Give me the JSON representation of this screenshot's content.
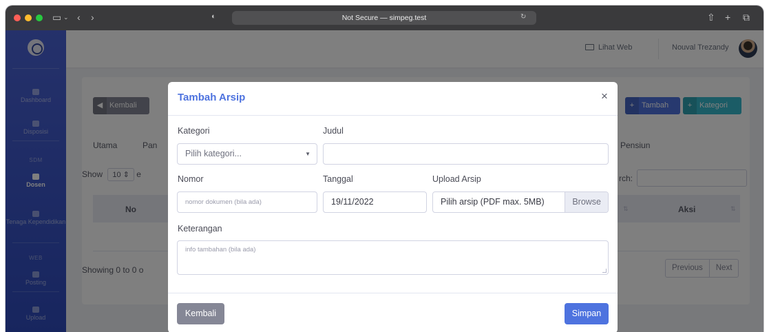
{
  "browser": {
    "url_text": "Not Secure — simpeg.test"
  },
  "sidebar": {
    "items": [
      {
        "label": "Dashboard"
      },
      {
        "label": "Disposisi"
      },
      {
        "label": "Dosen"
      },
      {
        "label": "Tenaga Kependidikan"
      },
      {
        "label": "Posting"
      },
      {
        "label": "Upload"
      }
    ],
    "headings": [
      "SDM",
      "WEB"
    ]
  },
  "topbar": {
    "lihat_web": "Lihat Web",
    "user_name": "Nouval Trezandy"
  },
  "page": {
    "back_button": "Kembali",
    "tambah_button": "Tambah",
    "kategori_button": "Kategori",
    "tabs": [
      "Utama",
      "Pan",
      "Pensiun"
    ],
    "show_label": "Show",
    "show_value": "10",
    "show_suffix": "e",
    "search_label": "rch:",
    "table_headers": [
      "No",
      "Aksi"
    ],
    "showing_text": "Showing 0 to 0 o",
    "pager": [
      "Previous",
      "Next"
    ]
  },
  "modal": {
    "title": "Tambah Arsip",
    "close": "×",
    "kategori_label": "Kategori",
    "kategori_value": "Pilih kategori...",
    "judul_label": "Judul",
    "judul_value": "",
    "nomor_label": "Nomor",
    "nomor_placeholder": "nomor dokumen (bila ada)",
    "tanggal_label": "Tanggal",
    "tanggal_value": "19/11/2022",
    "upload_label": "Upload Arsip",
    "upload_value": "Pilih arsip (PDF max. 5MB)",
    "browse_label": "Browse",
    "keterangan_label": "Keterangan",
    "keterangan_placeholder": "info tambahan (bila ada)",
    "kembali_button": "Kembali",
    "simpan_button": "Simpan"
  }
}
